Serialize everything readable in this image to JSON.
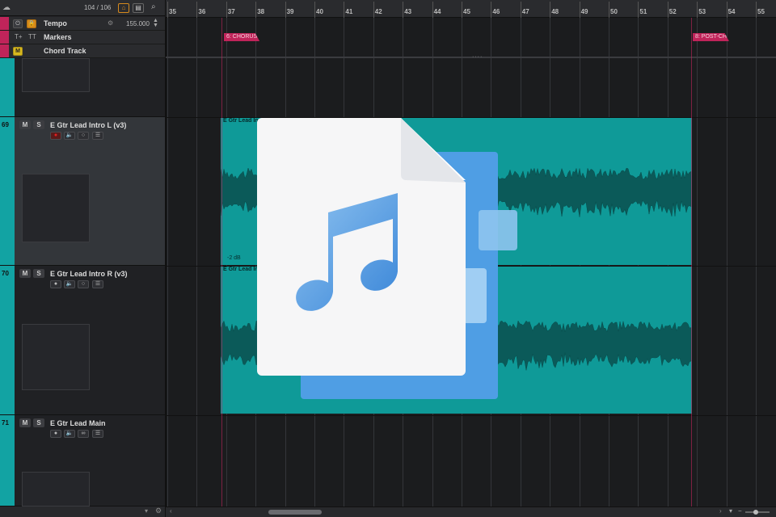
{
  "header": {
    "counter": "104 / 106"
  },
  "ruler": {
    "bars": [
      "35",
      "36",
      "37",
      "38",
      "39",
      "40",
      "41",
      "42",
      "43",
      "44",
      "45",
      "46",
      "47",
      "48",
      "49",
      "50",
      "51",
      "52",
      "53",
      "54",
      "55"
    ]
  },
  "global_tracks": [
    {
      "name": "Tempo",
      "value": "155.000"
    },
    {
      "name": "Markers"
    },
    {
      "name": "Chord Track",
      "badge": "M"
    }
  ],
  "markers": [
    {
      "label": "6: CHORUS"
    },
    {
      "label": "8: POST-CH"
    }
  ],
  "tracks": [
    {
      "number": "69",
      "name": "E Gtr Lead Intro L   (v3)",
      "mute": "M",
      "solo": "S",
      "event_label": "E Gtr Lead In",
      "gain": "-2 dB"
    },
    {
      "number": "70",
      "name": "E Gtr Lead Intro R   (v3)",
      "mute": "M",
      "solo": "S",
      "event_label": "E Gtr Lead In"
    },
    {
      "number": "71",
      "name": "E Gtr Lead Main",
      "mute": "M",
      "solo": "S"
    }
  ],
  "colors": {
    "accent_teal": "#12a3a3",
    "marker_red": "#c0245a",
    "overlay_blue": "#4fa0e6"
  },
  "overlay": {
    "icon": "music-file-icon"
  }
}
